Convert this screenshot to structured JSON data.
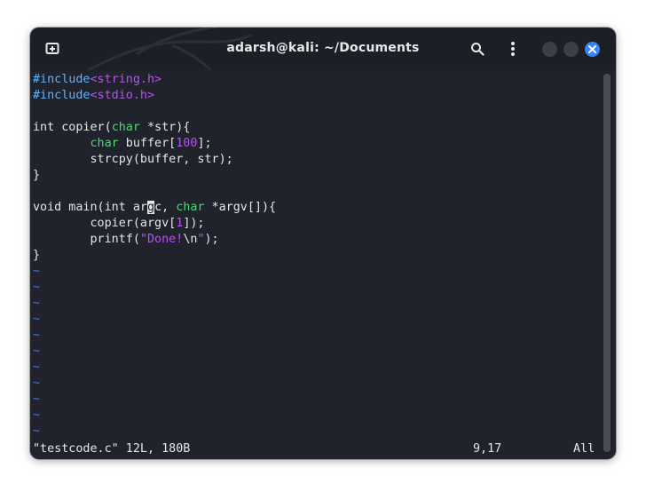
{
  "window": {
    "title": "adarsh@kali: ~/Documents"
  },
  "code": {
    "l1": {
      "kw": "#include",
      "file": "<string.h>"
    },
    "l2": {
      "kw": "#include",
      "file": "<stdio.h>"
    },
    "l4": {
      "a": "int copier(",
      "type": "char",
      "b": " *str){"
    },
    "l5": {
      "indent": "        ",
      "type": "char",
      "a": " buffer[",
      "num": "100",
      "b": "];"
    },
    "l6": {
      "text": "        strcpy(buffer, str);"
    },
    "l7": {
      "text": "}"
    },
    "l9": {
      "a": "void main(int ar",
      "cursor": "g",
      "b": "c, ",
      "type": "char",
      "c": " *argv[]){"
    },
    "l10": {
      "a": "        copier(argv[",
      "num": "1",
      "b": "]);"
    },
    "l11": {
      "a": "        printf(",
      "str1": "\"Done!",
      "esc": "\\n",
      "str2": "\"",
      "b": ");"
    },
    "l12": {
      "text": "}"
    },
    "tilde": "~"
  },
  "status": {
    "file": "\"testcode.c\" 12L, 180B",
    "position": "9,17",
    "scroll": "All"
  }
}
